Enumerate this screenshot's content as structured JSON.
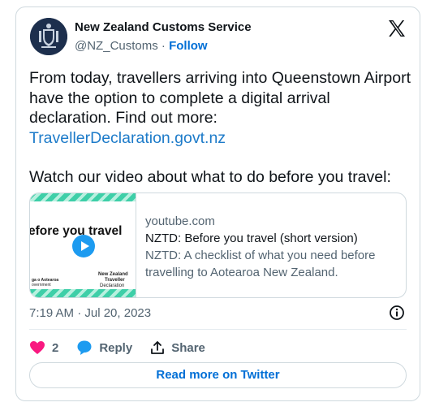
{
  "author": {
    "display_name": "New Zealand Customs Service",
    "handle": "@NZ_Customs",
    "separator": " · ",
    "follow_label": "Follow"
  },
  "tweet": {
    "paragraph1": "From today, travellers arriving into Queenstown Airport have the option to complete a digital arrival declaration. Find out more:",
    "link_text": "TravellerDeclaration.govt.nz",
    "paragraph2": "Watch our video about what to do before you travel:"
  },
  "link_card": {
    "thumbnail_title": "efore you travel",
    "thumbnail_logo_line1": "New Zealand",
    "thumbnail_logo_line2": "Traveller",
    "thumbnail_logo_line3": "Declaration",
    "thumbnail_gov_line1": "ga o Aotearoa",
    "thumbnail_gov_line2": "overnment",
    "domain": "youtube.com",
    "title": "NZTD: Before you travel (short version)",
    "description": "NZTD: A checklist of what you need before travelling to Aotearoa New Zealand."
  },
  "meta": {
    "timestamp": "7:19 AM · Jul 20, 2023"
  },
  "actions": {
    "like_count": "2",
    "reply_label": "Reply",
    "share_label": "Share"
  },
  "read_more_label": "Read more on Twitter",
  "colors": {
    "link": "#1d7bc9",
    "follow": "#006fd6",
    "like": "#f91880",
    "reply": "#1d9bf0",
    "border": "#cfd9de"
  },
  "icons": [
    "customs-logo-avatar",
    "x-logo-icon",
    "info-icon",
    "heart-icon",
    "reply-bubble-icon",
    "share-icon",
    "play-icon"
  ]
}
